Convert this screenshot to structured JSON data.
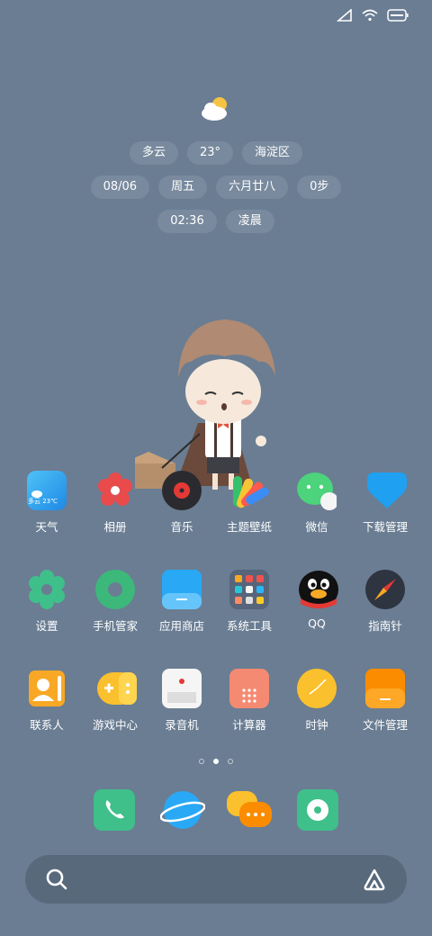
{
  "status_bar": {
    "icons": [
      "signal-icon",
      "wifi-icon",
      "battery-icon"
    ]
  },
  "weather": {
    "icon": "partly-cloudy-icon",
    "condition": "多云",
    "temperature": "23°",
    "location": "海淀区",
    "date": "08/06",
    "weekday": "周五",
    "lunar_date": "六月廿八",
    "steps": "0步",
    "time": "02:36",
    "period": "凌晨"
  },
  "apps": {
    "row1": [
      {
        "label": "天气",
        "icon": "weather-app-icon",
        "badge": "多云 23℃"
      },
      {
        "label": "相册",
        "icon": "gallery-icon"
      },
      {
        "label": "音乐",
        "icon": "music-icon"
      },
      {
        "label": "主题壁纸",
        "icon": "themes-icon"
      },
      {
        "label": "微信",
        "icon": "wechat-icon"
      },
      {
        "label": "下载管理",
        "icon": "downloads-icon"
      }
    ],
    "row2": [
      {
        "label": "设置",
        "icon": "settings-icon"
      },
      {
        "label": "手机管家",
        "icon": "security-icon"
      },
      {
        "label": "应用商店",
        "icon": "app-store-icon"
      },
      {
        "label": "系统工具",
        "icon": "system-tools-folder-icon"
      },
      {
        "label": "QQ",
        "icon": "qq-icon"
      },
      {
        "label": "指南针",
        "icon": "compass-icon"
      }
    ],
    "row3": [
      {
        "label": "联系人",
        "icon": "contacts-icon"
      },
      {
        "label": "游戏中心",
        "icon": "game-center-icon"
      },
      {
        "label": "录音机",
        "icon": "recorder-icon"
      },
      {
        "label": "计算器",
        "icon": "calculator-icon"
      },
      {
        "label": "时钟",
        "icon": "clock-icon"
      },
      {
        "label": "文件管理",
        "icon": "file-manager-icon"
      }
    ]
  },
  "pages": {
    "count": 3,
    "active": 2
  },
  "dock": [
    "phone-icon",
    "browser-icon",
    "messages-icon",
    "music-player-icon"
  ],
  "search": {
    "left_icon": "search-icon",
    "right_icon": "assistant-icon"
  },
  "colors": {
    "background": "#6a7d93",
    "search_bar": "#59697c"
  }
}
